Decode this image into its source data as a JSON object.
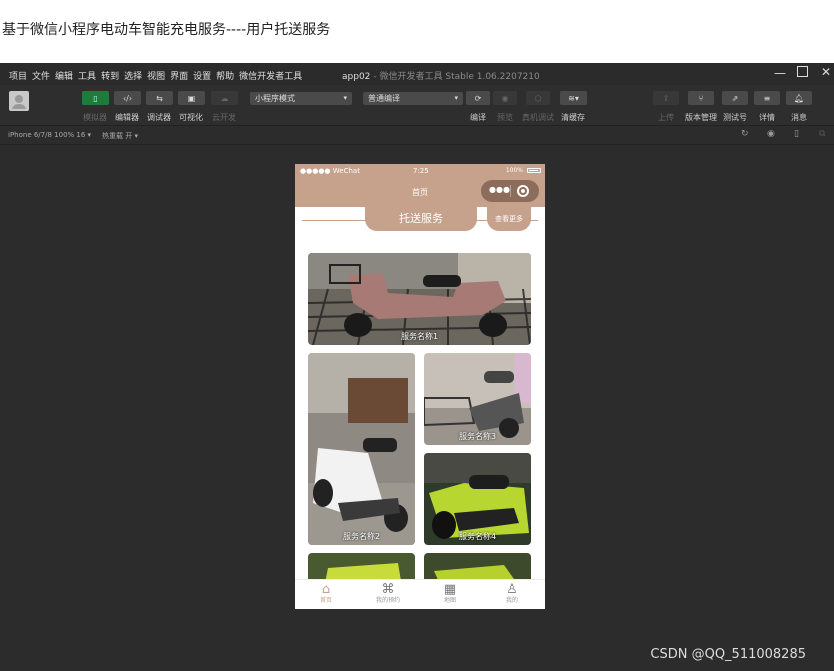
{
  "article": {
    "title": "基于微信小程序电动车智能充电服务----用户托送服务"
  },
  "window": {
    "menu": [
      "项目",
      "文件",
      "编辑",
      "工具",
      "转到",
      "选择",
      "视图",
      "界面",
      "设置",
      "帮助",
      "微信开发者工具"
    ],
    "app_name": "app02",
    "title_rest": "- 微信开发者工具 Stable 1.06.2207210"
  },
  "toolbar": {
    "simulator": "模拟器",
    "editor": "编辑器",
    "debugger": "调试器",
    "visual": "可视化",
    "cloud": "云开发",
    "mode_select": "小程序模式",
    "compile_select": "普通编译",
    "compile": "编译",
    "preview": "预览",
    "real_debug": "真机调试",
    "clear_cache": "清缓存",
    "upload": "上传",
    "version": "版本管理",
    "test_id": "测试号",
    "details": "详情",
    "messages": "消息"
  },
  "subbar": {
    "device": "iPhone 6/7/8 100% 16 ▾",
    "hot_reload": "热重载 开 ▾"
  },
  "phone": {
    "carrier": "●●●●● WeChat",
    "time": "7:25",
    "battery": "100%",
    "nav_title": "首页",
    "section_title": "托送服务",
    "more": "查看更多",
    "services": [
      {
        "label": "服务名称1"
      },
      {
        "label": "服务名称2"
      },
      {
        "label": "服务名称3"
      },
      {
        "label": "服务名称4"
      }
    ],
    "tabs": [
      {
        "label": "首页"
      },
      {
        "label": "我的预约"
      },
      {
        "label": "地图"
      },
      {
        "label": "我的"
      }
    ]
  },
  "watermark": "CSDN @QQ_511008285"
}
